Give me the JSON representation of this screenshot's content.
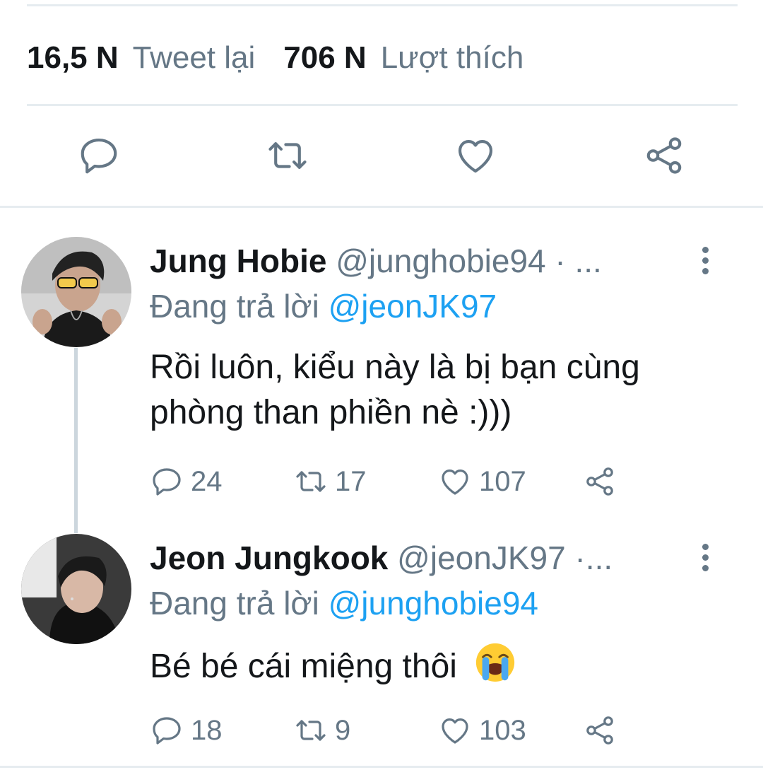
{
  "stats": {
    "retweet_count": "16,5 N",
    "retweet_label": "Tweet lại",
    "like_count": "706 N",
    "like_label": "Lượt thích"
  },
  "main_actions": {
    "icons": [
      "reply-icon",
      "retweet-icon",
      "like-icon",
      "share-icon"
    ]
  },
  "replies": [
    {
      "name": "Jung Hobie",
      "handle": "@junghobie94 · ...",
      "replying_label": "Đang trả lời ",
      "replying_to": "@jeonJK97",
      "text_line1": "Rồi luôn, kiểu này là bị bạn cùng",
      "text_line2": "phòng than phiền nè :)))",
      "reply_count": "24",
      "retweet_count": "17",
      "like_count": "107"
    },
    {
      "name": "Jeon Jungkook",
      "handle": "@jeonJK97 ·...",
      "replying_label": "Đang trả lời ",
      "replying_to": "@junghobie94",
      "text": "Bé bé cái miệng thôi",
      "emoji": "loudly-crying-face",
      "reply_count": "18",
      "retweet_count": "9",
      "like_count": "103"
    }
  ],
  "colors": {
    "text": "#14171a",
    "secondary": "#657786",
    "link": "#1da1f2",
    "divider": "#e6ecf0"
  }
}
